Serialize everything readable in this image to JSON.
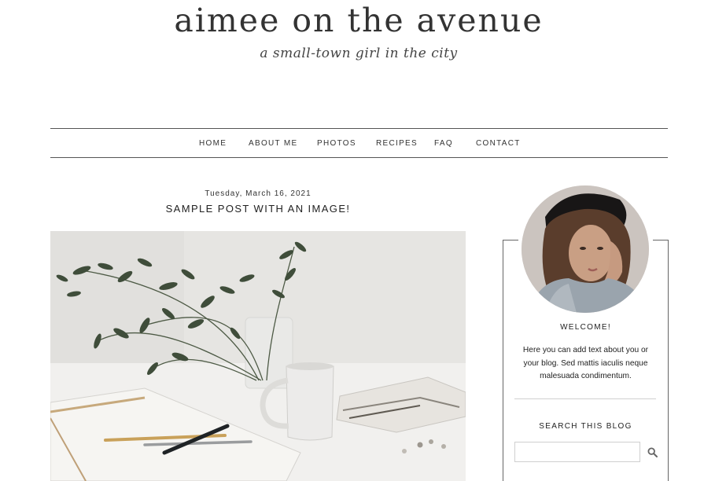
{
  "header": {
    "title": "aimee on the avenue",
    "tagline": "a small-town girl in the city"
  },
  "nav": {
    "items": [
      "HOME",
      "ABOUT ME",
      "PHOTOS",
      "RECIPES",
      "FAQ",
      "CONTACT"
    ]
  },
  "post": {
    "date": "Tuesday, March 16, 2021",
    "title": "SAMPLE POST WITH AN IMAGE!"
  },
  "sidebar": {
    "welcome_heading": "WELCOME!",
    "about_text": "Here you can add text about you or your blog. Sed mattis iaculis neque malesuada condimentum.",
    "search_heading": "SEARCH THIS BLOG",
    "search_placeholder": "",
    "search_icon": "search-icon"
  }
}
